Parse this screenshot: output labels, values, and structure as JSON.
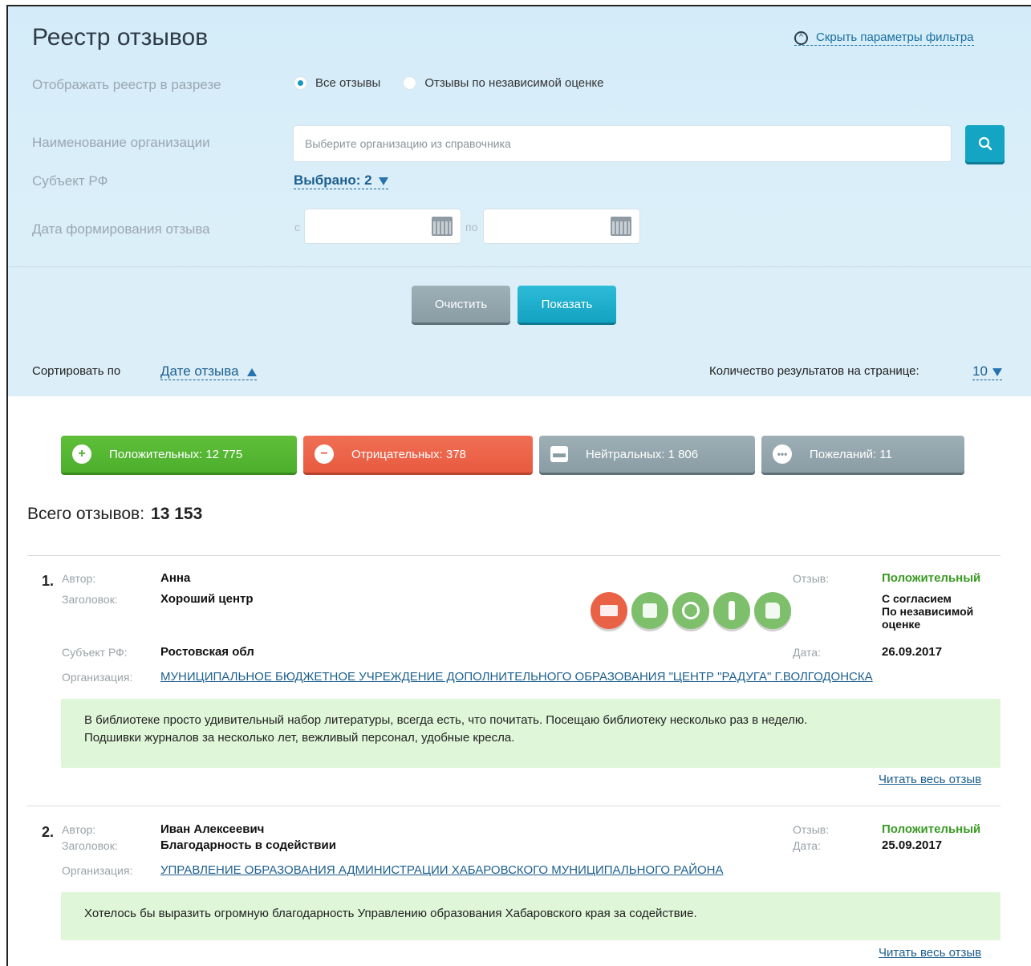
{
  "page": {
    "title": "Реестр отзывов",
    "hide_filter_label": "Скрыть параметры фильтра"
  },
  "filter": {
    "display_label": "Отображать реестр в разрезе",
    "radio_all": "Все отзывы",
    "radio_independent": "Отзывы по независимой оценке",
    "org_label": "Наименование организации",
    "org_placeholder": "Выберите организацию из справочника",
    "subject_label": "Субъект РФ",
    "subject_value": "Выбрано: 2",
    "date_label": "Дата формирования отзыва",
    "date_from_prefix": "с",
    "date_to_prefix": "по",
    "clear_label": "Очистить",
    "show_label": "Показать"
  },
  "sort": {
    "label": "Сортировать по",
    "value": "Дате отзыва",
    "count_label": "Количество результатов на странице:",
    "count_value": "10"
  },
  "tabs": {
    "positive": "Положительных: 12 775",
    "negative": "Отрицательных: 378",
    "neutral": "Нейтральных: 1 806",
    "wishes": "Пожеланий: 11"
  },
  "total": {
    "label": "Всего отзывов:",
    "value": "13 153"
  },
  "colors": {
    "accent": "#14a5c4",
    "positive": "#4caf2c",
    "negative": "#e85b40",
    "neutral": "#8a9ca4",
    "link": "#1c5f8e"
  },
  "reviews": [
    {
      "num": "1.",
      "author_key": "Автор:",
      "author": "Анна",
      "title_key": "Заголовок:",
      "title": "Хороший центр",
      "subject_key": "Субъект РФ:",
      "subject": "Ростовская обл",
      "org_key": "Организация:",
      "org": "МУНИЦИПАЛЬНОЕ БЮДЖЕТНОЕ УЧРЕЖДЕНИЕ ДОПОЛНИТЕЛЬНОГО ОБРАЗОВАНИЯ \"ЦЕНТР \"РАДУГА\" Г.ВОЛГОДОНСКА",
      "review_key": "Отзыв:",
      "review_type": "Положительный",
      "consent_1": "С согласием",
      "consent_2": "По независимой",
      "consent_3": "оценке",
      "date_key": "Дата:",
      "date": "26.09.2017",
      "text_1": "В библиотеке просто удивительный набор литературы, всегда есть, что почитать. Посещаю библиотеку несколько раз в неделю.",
      "text_2": "Подшивки журналов за несколько лет, вежливый персонал, удобные кресла.",
      "read_more": "Читать весь отзыв",
      "icons": [
        "inbox-icon",
        "coffee-icon",
        "clock-icon",
        "tie-icon",
        "thumbs-up-icon"
      ]
    },
    {
      "num": "2.",
      "author_key": "Автор:",
      "author": "Иван Алексеевич",
      "title_key": "Заголовок:",
      "title": "Благодарность в содействии",
      "org_key": "Организация:",
      "org": "УПРАВЛЕНИЕ ОБРАЗОВАНИЯ АДМИНИСТРАЦИИ ХАБАРОВСКОГО МУНИЦИПАЛЬНОГО РАЙОНА",
      "review_key": "Отзыв:",
      "review_type": "Положительный",
      "date_key": "Дата:",
      "date": "25.09.2017",
      "text_1": "Хотелось бы выразить огромную благодарность Управлению образования Хабаровского края за содействие.",
      "read_more": "Читать весь отзыв"
    }
  ]
}
